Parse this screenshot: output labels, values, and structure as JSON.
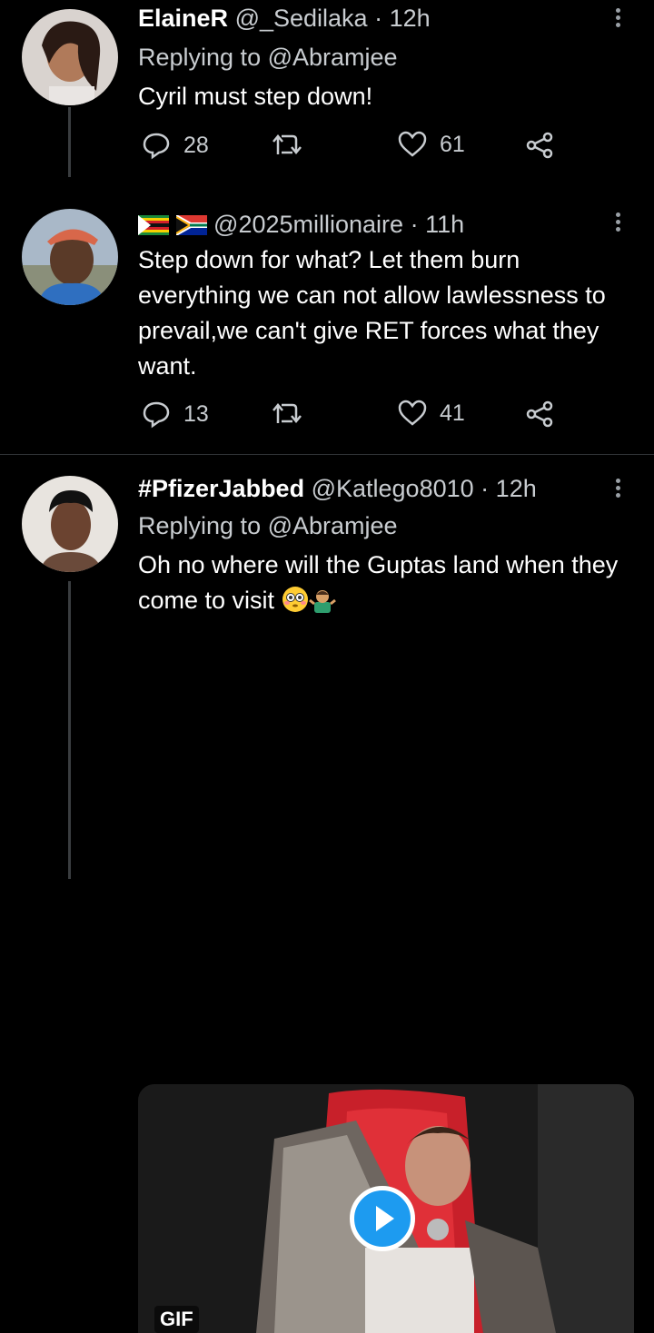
{
  "tweets": [
    {
      "name": "ElaineR",
      "handle": "@_Sedilaka",
      "separator": "·",
      "time": "12h",
      "replying_to": "Replying to @Abramjee",
      "text": "Cyril must step down!",
      "replies": "28",
      "likes": "61"
    },
    {
      "name": "",
      "handle": "@2025millionaire",
      "separator": "·",
      "time": "11h",
      "text": "Step down for what? Let them burn everything we can not allow lawlessness to prevail,we can't give RET forces what they want.",
      "replies": "13",
      "likes": "41"
    },
    {
      "name": "#PfizerJabbed",
      "handle": "@Katlego8010",
      "separator": "·",
      "time": "12h",
      "replying_to": "Replying to @Abramjee",
      "text": "Oh no where will the Guptas land when they come to visit",
      "media_badge": "GIF"
    }
  ],
  "colors": {
    "background": "#000000",
    "secondary_text": "#c8ccd0",
    "accent": "#1d9bf0",
    "divider": "#2f3336"
  },
  "icons": [
    "reply-icon",
    "retweet-icon",
    "like-icon",
    "share-icon",
    "more-icon",
    "play-icon"
  ]
}
